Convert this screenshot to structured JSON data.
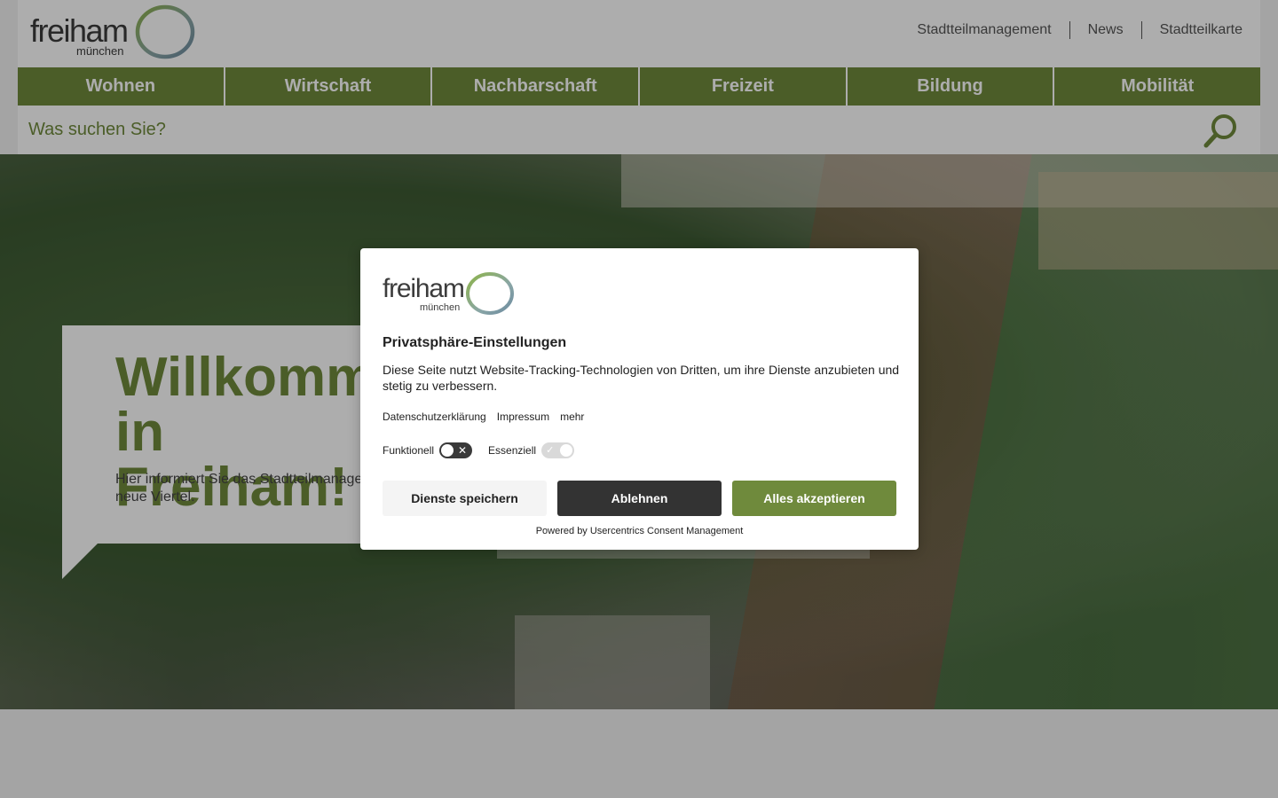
{
  "brand": {
    "name": "freiham",
    "sub": "münchen"
  },
  "header": {
    "links": [
      "Stadtteilmanagement",
      "News",
      "Stadtteilkarte"
    ]
  },
  "nav": {
    "items": [
      "Wohnen",
      "Wirtschaft",
      "Nachbarschaft",
      "Freizeit",
      "Bildung",
      "Mobilität"
    ]
  },
  "search": {
    "placeholder": "Was suchen Sie?"
  },
  "hero": {
    "title": "Willkommen in\nFreiham!",
    "text": "Hier informiert Sie das Stadtteilmanagement über das neue Viertel."
  },
  "consent": {
    "title": "Privatsphäre-Einstellungen",
    "text": "Diese Seite nutzt Website-Tracking-Technologien von Dritten, um ihre Dienste anzubieten und stetig zu verbessern.",
    "links": [
      "Datenschutzerklärung",
      "Impressum",
      "mehr"
    ],
    "toggles": [
      {
        "label": "Funktionell",
        "state": "off"
      },
      {
        "label": "Essenziell",
        "state": "on"
      }
    ],
    "buttons": {
      "save": "Dienste speichern",
      "decline": "Ablehnen",
      "accept": "Alles akzeptieren"
    },
    "powered_by": "Powered by Usercentrics Consent Management"
  },
  "colors": {
    "accent": "#6f8a3c",
    "dark_button": "#333333",
    "overlay": "rgba(0,0,0,0.32)"
  }
}
